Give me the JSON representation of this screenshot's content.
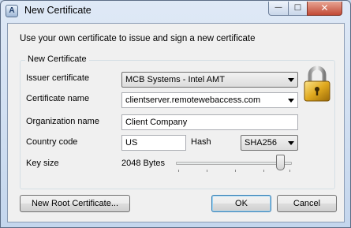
{
  "window": {
    "title": "New Certificate",
    "app_icon_glyph": "A",
    "controls": {
      "minimize": "—",
      "maximize": "□",
      "close": "✕"
    }
  },
  "intro_text": "Use your own certificate to issue and sign a new certificate",
  "group": {
    "legend": "New Certificate",
    "issuer_label": "Issuer certificate",
    "issuer_value": "MCB Systems - Intel AMT",
    "certname_label": "Certificate name",
    "certname_value": "clientserver.remotewebaccess.com",
    "org_label": "Organization name",
    "org_value": "Client Company",
    "country_label": "Country code",
    "country_value": "US",
    "hash_label": "Hash",
    "hash_value": "SHA256",
    "keysize_label": "Key size",
    "keysize_value": "2048 Bytes",
    "keysize_slider_fraction": 0.9
  },
  "buttons": {
    "new_root": "New Root Certificate...",
    "ok": "OK",
    "cancel": "Cancel"
  },
  "icons": [
    "lock-icon",
    "app-icon"
  ],
  "colors": {
    "close_button": "#c24a36",
    "title_gradient_top": "#dfe9f6",
    "client_bg": "#f0f0f0"
  }
}
